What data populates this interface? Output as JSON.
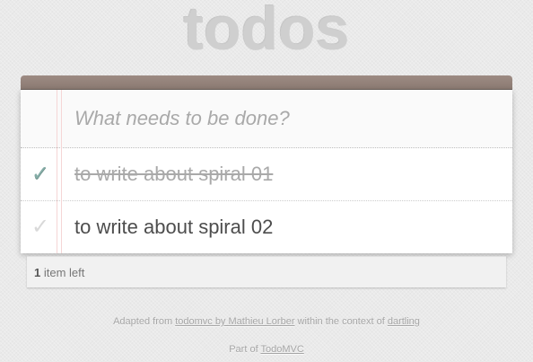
{
  "header": {
    "title": "todos"
  },
  "new_todo": {
    "placeholder": "What needs to be done?",
    "value": ""
  },
  "todos": [
    {
      "label": "to write about spiral 01",
      "completed": true
    },
    {
      "label": "to write about spiral 02",
      "completed": false
    }
  ],
  "footer": {
    "count": "1",
    "count_suffix": " item left"
  },
  "info": {
    "line1_prefix": "Adapted from ",
    "line1_link1": "todomvc by Mathieu Lorber",
    "line1_middle": " within the context of ",
    "line1_link2": "dartling",
    "line2_prefix": "Part of ",
    "line2_link": "TodoMVC"
  },
  "icons": {
    "toggle_checked": "check-icon",
    "toggle_unchecked": "check-icon"
  },
  "colors": {
    "header_band": "#9d8b83",
    "check_completed": "#85ada7",
    "check_pending": "#d9d9d9",
    "title": "#cfcfcf"
  }
}
